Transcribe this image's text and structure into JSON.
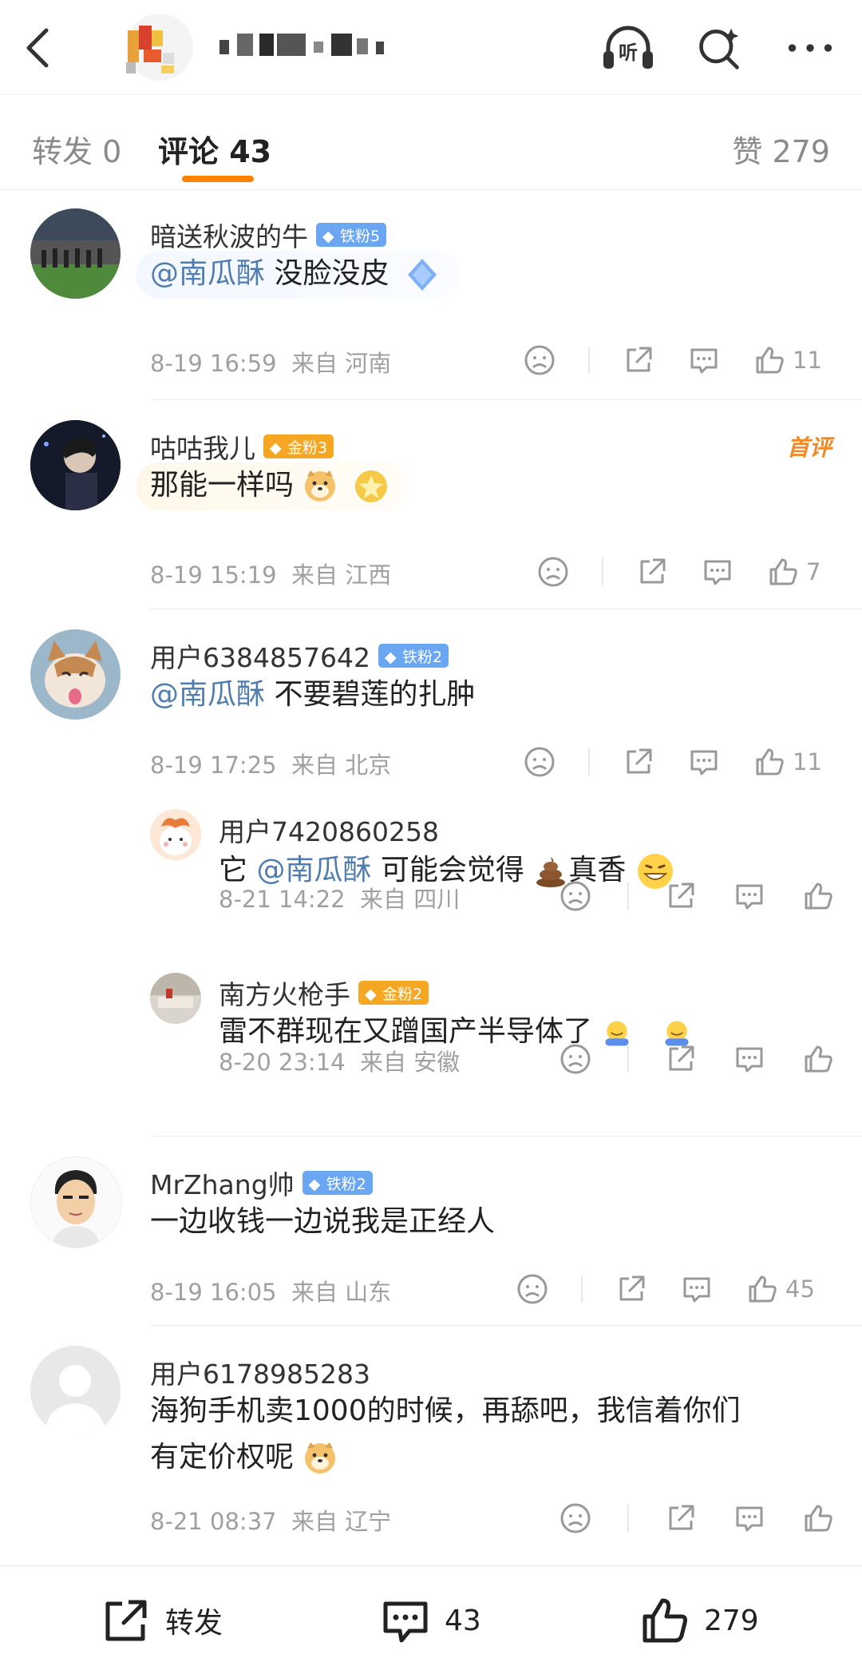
{
  "tabs": {
    "repost": "转发 0",
    "comments": "评论 43",
    "likes": "赞 279"
  },
  "header": {
    "listen_label": "听"
  },
  "comments": [
    {
      "username": "暗送秋波的牛",
      "badge": "铁粉5",
      "mention": "@南瓜酥",
      "text": " 没脸没皮",
      "time": "8-19 16:59",
      "from": "来自 河南",
      "likes": "11"
    },
    {
      "username": "咕咕我儿",
      "badge": "金粉3",
      "text": "那能一样吗",
      "tag": "首评",
      "time": "8-19 15:19",
      "from": "来自 江西",
      "likes": "7"
    },
    {
      "username": "用户6384857642",
      "badge": "铁粉2",
      "mention": "@南瓜酥",
      "text": " 不要碧莲的扎肿",
      "time": "8-19 17:25",
      "from": "来自 北京",
      "likes": "11",
      "replies": [
        {
          "username": "用户7420860258",
          "prefix": "它 ",
          "mention": "@南瓜酥",
          "text": " 可能会觉得",
          "suffix": "真香",
          "time": "8-21 14:22",
          "from": "来自 四川"
        },
        {
          "username": "南方火枪手",
          "badge": "金粉2",
          "text": "雷不群现在又蹭国产半导体了",
          "time": "8-20 23:14",
          "from": "来自 安徽"
        }
      ]
    },
    {
      "username": "MrZhang帅",
      "badge": "铁粉2",
      "text": "一边收钱一边说我是正经人",
      "time": "8-19 16:05",
      "from": "来自 山东",
      "likes": "45"
    },
    {
      "username": "用户6178985283",
      "text_line1": "海狗手机卖1000的时候，再舔吧，我信着你们",
      "text_line2": "有定价权呢",
      "time": "8-21 08:37",
      "from": "来自 辽宁"
    }
  ],
  "bottom": {
    "repost_label": "转发",
    "comment_count": "43",
    "like_count": "279"
  },
  "colors": {
    "accent": "#ff8200",
    "mention": "#507daf",
    "iron_badge": "#6aa6f2",
    "gold_badge": "#f5a623"
  }
}
